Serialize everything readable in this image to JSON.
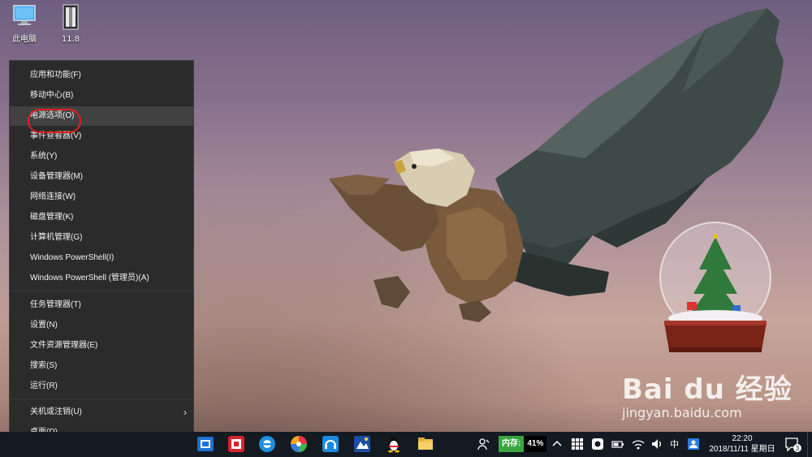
{
  "desktop": {
    "icons": [
      {
        "label": "此电脑"
      },
      {
        "label": "11.8"
      }
    ]
  },
  "menu": {
    "items": [
      {
        "label": "应用和功能(F)"
      },
      {
        "label": "移动中心(B)"
      },
      {
        "label": "电源选项(O)"
      },
      {
        "label": "事件查看器(V)"
      },
      {
        "label": "系统(Y)"
      },
      {
        "label": "设备管理器(M)"
      },
      {
        "label": "网络连接(W)"
      },
      {
        "label": "磁盘管理(K)"
      },
      {
        "label": "计算机管理(G)"
      },
      {
        "label": "Windows PowerShell(I)"
      },
      {
        "label": "Windows PowerShell (管理员)(A)"
      },
      {
        "label": "任务管理器(T)"
      },
      {
        "label": "设置(N)"
      },
      {
        "label": "文件资源管理器(E)"
      },
      {
        "label": "搜索(S)"
      },
      {
        "label": "运行(R)"
      },
      {
        "label": "关机或注销(U)"
      },
      {
        "label": "桌面(D)"
      }
    ],
    "highlighted": "电源选项(O)"
  },
  "taskbar": {
    "memory_label": "内存:",
    "memory_value": "41%",
    "ime": "中",
    "time": "22:20",
    "date": "2018/11/11 星期日",
    "notification_count": "3"
  },
  "watermark": {
    "main": "Bai du 经验",
    "sub": "jingyan.baidu.com"
  },
  "colors": {
    "menu_bg": "#2b2b2b",
    "menu_highlight": "#414141",
    "annotation_ring": "#e02020",
    "taskbar_bg": "#141a22",
    "memory_green": "#3aa63f"
  }
}
